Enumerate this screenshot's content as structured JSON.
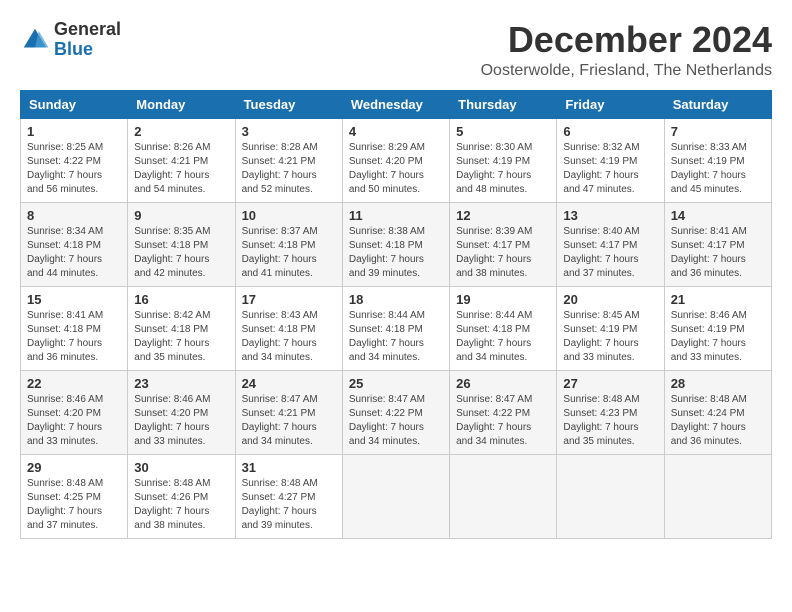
{
  "header": {
    "logo": {
      "general": "General",
      "blue": "Blue"
    },
    "title": "December 2024",
    "location": "Oosterwolde, Friesland, The Netherlands"
  },
  "calendar": {
    "days_of_week": [
      "Sunday",
      "Monday",
      "Tuesday",
      "Wednesday",
      "Thursday",
      "Friday",
      "Saturday"
    ],
    "weeks": [
      [
        {
          "day": "1",
          "sunrise": "8:25 AM",
          "sunset": "4:22 PM",
          "daylight": "7 hours and 56 minutes."
        },
        {
          "day": "2",
          "sunrise": "8:26 AM",
          "sunset": "4:21 PM",
          "daylight": "7 hours and 54 minutes."
        },
        {
          "day": "3",
          "sunrise": "8:28 AM",
          "sunset": "4:21 PM",
          "daylight": "7 hours and 52 minutes."
        },
        {
          "day": "4",
          "sunrise": "8:29 AM",
          "sunset": "4:20 PM",
          "daylight": "7 hours and 50 minutes."
        },
        {
          "day": "5",
          "sunrise": "8:30 AM",
          "sunset": "4:19 PM",
          "daylight": "7 hours and 48 minutes."
        },
        {
          "day": "6",
          "sunrise": "8:32 AM",
          "sunset": "4:19 PM",
          "daylight": "7 hours and 47 minutes."
        },
        {
          "day": "7",
          "sunrise": "8:33 AM",
          "sunset": "4:19 PM",
          "daylight": "7 hours and 45 minutes."
        }
      ],
      [
        {
          "day": "8",
          "sunrise": "8:34 AM",
          "sunset": "4:18 PM",
          "daylight": "7 hours and 44 minutes."
        },
        {
          "day": "9",
          "sunrise": "8:35 AM",
          "sunset": "4:18 PM",
          "daylight": "7 hours and 42 minutes."
        },
        {
          "day": "10",
          "sunrise": "8:37 AM",
          "sunset": "4:18 PM",
          "daylight": "7 hours and 41 minutes."
        },
        {
          "day": "11",
          "sunrise": "8:38 AM",
          "sunset": "4:18 PM",
          "daylight": "7 hours and 39 minutes."
        },
        {
          "day": "12",
          "sunrise": "8:39 AM",
          "sunset": "4:17 PM",
          "daylight": "7 hours and 38 minutes."
        },
        {
          "day": "13",
          "sunrise": "8:40 AM",
          "sunset": "4:17 PM",
          "daylight": "7 hours and 37 minutes."
        },
        {
          "day": "14",
          "sunrise": "8:41 AM",
          "sunset": "4:17 PM",
          "daylight": "7 hours and 36 minutes."
        }
      ],
      [
        {
          "day": "15",
          "sunrise": "8:41 AM",
          "sunset": "4:18 PM",
          "daylight": "7 hours and 36 minutes."
        },
        {
          "day": "16",
          "sunrise": "8:42 AM",
          "sunset": "4:18 PM",
          "daylight": "7 hours and 35 minutes."
        },
        {
          "day": "17",
          "sunrise": "8:43 AM",
          "sunset": "4:18 PM",
          "daylight": "7 hours and 34 minutes."
        },
        {
          "day": "18",
          "sunrise": "8:44 AM",
          "sunset": "4:18 PM",
          "daylight": "7 hours and 34 minutes."
        },
        {
          "day": "19",
          "sunrise": "8:44 AM",
          "sunset": "4:18 PM",
          "daylight": "7 hours and 34 minutes."
        },
        {
          "day": "20",
          "sunrise": "8:45 AM",
          "sunset": "4:19 PM",
          "daylight": "7 hours and 33 minutes."
        },
        {
          "day": "21",
          "sunrise": "8:46 AM",
          "sunset": "4:19 PM",
          "daylight": "7 hours and 33 minutes."
        }
      ],
      [
        {
          "day": "22",
          "sunrise": "8:46 AM",
          "sunset": "4:20 PM",
          "daylight": "7 hours and 33 minutes."
        },
        {
          "day": "23",
          "sunrise": "8:46 AM",
          "sunset": "4:20 PM",
          "daylight": "7 hours and 33 minutes."
        },
        {
          "day": "24",
          "sunrise": "8:47 AM",
          "sunset": "4:21 PM",
          "daylight": "7 hours and 34 minutes."
        },
        {
          "day": "25",
          "sunrise": "8:47 AM",
          "sunset": "4:22 PM",
          "daylight": "7 hours and 34 minutes."
        },
        {
          "day": "26",
          "sunrise": "8:47 AM",
          "sunset": "4:22 PM",
          "daylight": "7 hours and 34 minutes."
        },
        {
          "day": "27",
          "sunrise": "8:48 AM",
          "sunset": "4:23 PM",
          "daylight": "7 hours and 35 minutes."
        },
        {
          "day": "28",
          "sunrise": "8:48 AM",
          "sunset": "4:24 PM",
          "daylight": "7 hours and 36 minutes."
        }
      ],
      [
        {
          "day": "29",
          "sunrise": "8:48 AM",
          "sunset": "4:25 PM",
          "daylight": "7 hours and 37 minutes."
        },
        {
          "day": "30",
          "sunrise": "8:48 AM",
          "sunset": "4:26 PM",
          "daylight": "7 hours and 38 minutes."
        },
        {
          "day": "31",
          "sunrise": "8:48 AM",
          "sunset": "4:27 PM",
          "daylight": "7 hours and 39 minutes."
        },
        null,
        null,
        null,
        null
      ]
    ]
  }
}
